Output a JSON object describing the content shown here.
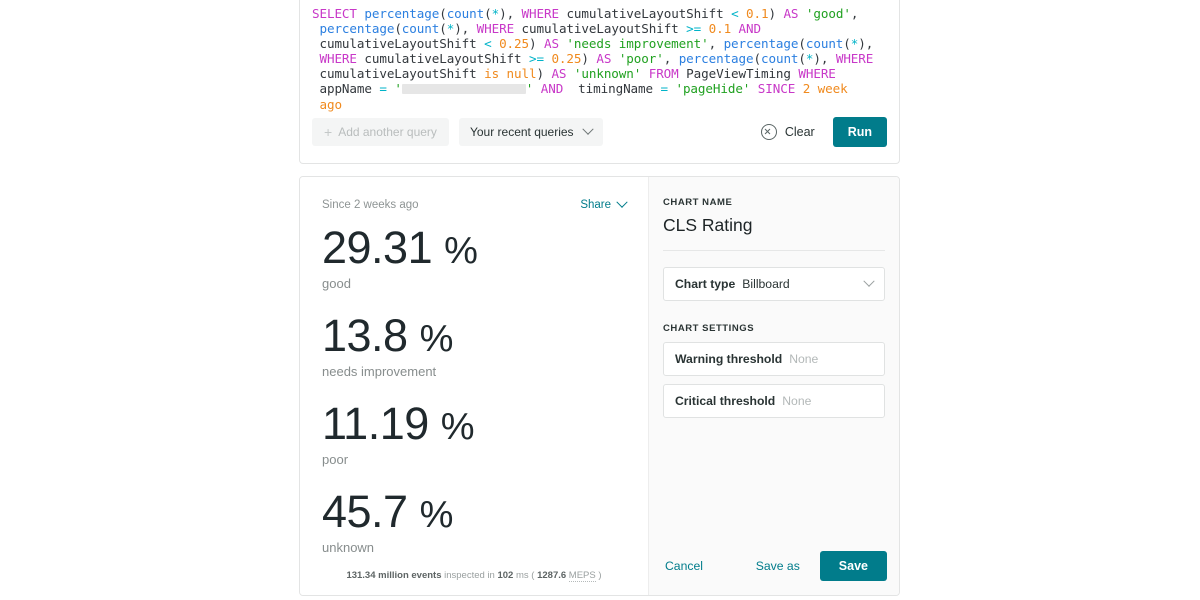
{
  "query_card": {
    "query_tokens": [
      {
        "t": "SELECT",
        "c": "kw"
      },
      {
        "t": " ",
        "c": "plain"
      },
      {
        "t": "percentage",
        "c": "fn"
      },
      {
        "t": "(",
        "c": "plain"
      },
      {
        "t": "count",
        "c": "fn"
      },
      {
        "t": "(",
        "c": "plain"
      },
      {
        "t": "*",
        "c": "op"
      },
      {
        "t": "), ",
        "c": "plain"
      },
      {
        "t": "WHERE",
        "c": "kw"
      },
      {
        "t": " cumulativeLayoutShift ",
        "c": "ident"
      },
      {
        "t": "<",
        "c": "op"
      },
      {
        "t": " ",
        "c": "plain"
      },
      {
        "t": "0.1",
        "c": "num"
      },
      {
        "t": ") ",
        "c": "plain"
      },
      {
        "t": "AS",
        "c": "kw"
      },
      {
        "t": " ",
        "c": "plain"
      },
      {
        "t": "'good'",
        "c": "str"
      },
      {
        "t": ",\n ",
        "c": "plain"
      },
      {
        "t": "percentage",
        "c": "fn"
      },
      {
        "t": "(",
        "c": "plain"
      },
      {
        "t": "count",
        "c": "fn"
      },
      {
        "t": "(",
        "c": "plain"
      },
      {
        "t": "*",
        "c": "op"
      },
      {
        "t": "), ",
        "c": "plain"
      },
      {
        "t": "WHERE",
        "c": "kw"
      },
      {
        "t": " cumulativeLayoutShift ",
        "c": "ident"
      },
      {
        "t": ">=",
        "c": "op"
      },
      {
        "t": " ",
        "c": "plain"
      },
      {
        "t": "0.1",
        "c": "num"
      },
      {
        "t": " ",
        "c": "plain"
      },
      {
        "t": "AND",
        "c": "kw"
      },
      {
        "t": "\n cumulativeLayoutShift ",
        "c": "ident"
      },
      {
        "t": "<",
        "c": "op"
      },
      {
        "t": " ",
        "c": "plain"
      },
      {
        "t": "0.25",
        "c": "num"
      },
      {
        "t": ") ",
        "c": "plain"
      },
      {
        "t": "AS",
        "c": "kw"
      },
      {
        "t": " ",
        "c": "plain"
      },
      {
        "t": "'needs improvement'",
        "c": "str"
      },
      {
        "t": ", ",
        "c": "plain"
      },
      {
        "t": "percentage",
        "c": "fn"
      },
      {
        "t": "(",
        "c": "plain"
      },
      {
        "t": "count",
        "c": "fn"
      },
      {
        "t": "(",
        "c": "plain"
      },
      {
        "t": "*",
        "c": "op"
      },
      {
        "t": "),\n",
        "c": "plain"
      },
      {
        "t": " ",
        "c": "plain"
      },
      {
        "t": "WHERE",
        "c": "kw"
      },
      {
        "t": " cumulativeLayoutShift ",
        "c": "ident"
      },
      {
        "t": ">=",
        "c": "op"
      },
      {
        "t": " ",
        "c": "plain"
      },
      {
        "t": "0.25",
        "c": "num"
      },
      {
        "t": ") ",
        "c": "plain"
      },
      {
        "t": "AS",
        "c": "kw"
      },
      {
        "t": " ",
        "c": "plain"
      },
      {
        "t": "'poor'",
        "c": "str"
      },
      {
        "t": ", ",
        "c": "plain"
      },
      {
        "t": "percentage",
        "c": "fn"
      },
      {
        "t": "(",
        "c": "plain"
      },
      {
        "t": "count",
        "c": "fn"
      },
      {
        "t": "(",
        "c": "plain"
      },
      {
        "t": "*",
        "c": "op"
      },
      {
        "t": "), ",
        "c": "plain"
      },
      {
        "t": "WHERE",
        "c": "kw"
      },
      {
        "t": "\n cumulativeLayoutShift ",
        "c": "ident"
      },
      {
        "t": "is null",
        "c": "num"
      },
      {
        "t": ") ",
        "c": "plain"
      },
      {
        "t": "AS",
        "c": "kw"
      },
      {
        "t": " ",
        "c": "plain"
      },
      {
        "t": "'unknown'",
        "c": "str"
      },
      {
        "t": " ",
        "c": "plain"
      },
      {
        "t": "FROM",
        "c": "kw"
      },
      {
        "t": " PageViewTiming ",
        "c": "ident"
      },
      {
        "t": "WHERE",
        "c": "kw"
      },
      {
        "t": "\n appName ",
        "c": "ident"
      },
      {
        "t": "=",
        "c": "op"
      },
      {
        "t": " ",
        "c": "plain"
      },
      {
        "t": "'",
        "c": "str"
      },
      {
        "t": "[REDACTED]",
        "c": "redacted"
      },
      {
        "t": "'",
        "c": "str"
      },
      {
        "t": " ",
        "c": "plain"
      },
      {
        "t": "AND",
        "c": "kw"
      },
      {
        "t": "  timingName ",
        "c": "ident"
      },
      {
        "t": "=",
        "c": "op"
      },
      {
        "t": " ",
        "c": "plain"
      },
      {
        "t": "'pageHide'",
        "c": "str"
      },
      {
        "t": " ",
        "c": "plain"
      },
      {
        "t": "SINCE",
        "c": "kw"
      },
      {
        "t": " ",
        "c": "plain"
      },
      {
        "t": "2 week",
        "c": "num"
      },
      {
        "t": "\n ",
        "c": "plain"
      },
      {
        "t": "ago",
        "c": "num"
      }
    ],
    "toolbar": {
      "add_query_label": "Add another query",
      "recent_queries_label": "Your recent queries",
      "clear_label": "Clear",
      "run_label": "Run"
    }
  },
  "result_card": {
    "viz": {
      "since_label": "Since 2 weeks ago",
      "share_label": "Share",
      "footer": {
        "events": "131.34 million events",
        "inspected_in": "inspected in",
        "duration": "102",
        "duration_unit": "ms",
        "open_paren": "(",
        "rate": "1287.6",
        "rate_unit": "MEPS",
        "close_paren": ")"
      }
    },
    "settings": {
      "chart_name_caption": "CHART NAME",
      "chart_name": "CLS Rating",
      "chart_type_label": "Chart type",
      "chart_type_value": "Billboard",
      "chart_settings_caption": "CHART SETTINGS",
      "warning_threshold_label": "Warning threshold",
      "warning_threshold_value": "None",
      "critical_threshold_label": "Critical threshold",
      "critical_threshold_value": "None",
      "cancel_label": "Cancel",
      "save_as_label": "Save as",
      "save_label": "Save"
    }
  },
  "chart_data": {
    "type": "table",
    "title": "CLS Rating",
    "subtitle": "Since 2 weeks ago",
    "unit": "%",
    "categories": [
      "good",
      "needs improvement",
      "poor",
      "unknown"
    ],
    "values": [
      29.31,
      13.8,
      11.19,
      45.7
    ],
    "display_values": [
      "29.31",
      "13.8",
      "11.19",
      "45.7"
    ],
    "billboards": [
      {
        "value": "29.31",
        "unit": "%",
        "label": "good"
      },
      {
        "value": "13.8",
        "unit": "%",
        "label": "needs improvement"
      },
      {
        "value": "11.19",
        "unit": "%",
        "label": "poor"
      },
      {
        "value": "45.7",
        "unit": "%",
        "label": "unknown"
      }
    ]
  },
  "colors": {
    "accent": "#017c8b",
    "text": "#2a3434",
    "muted": "#8e9494",
    "panel_bg": "#fafafa",
    "border": "#e3e4e4",
    "syntax_keyword": "#c838c8",
    "syntax_function": "#2b7fe0",
    "syntax_operator": "#00b3c8",
    "syntax_number": "#f08a1e",
    "syntax_string": "#21a121"
  }
}
